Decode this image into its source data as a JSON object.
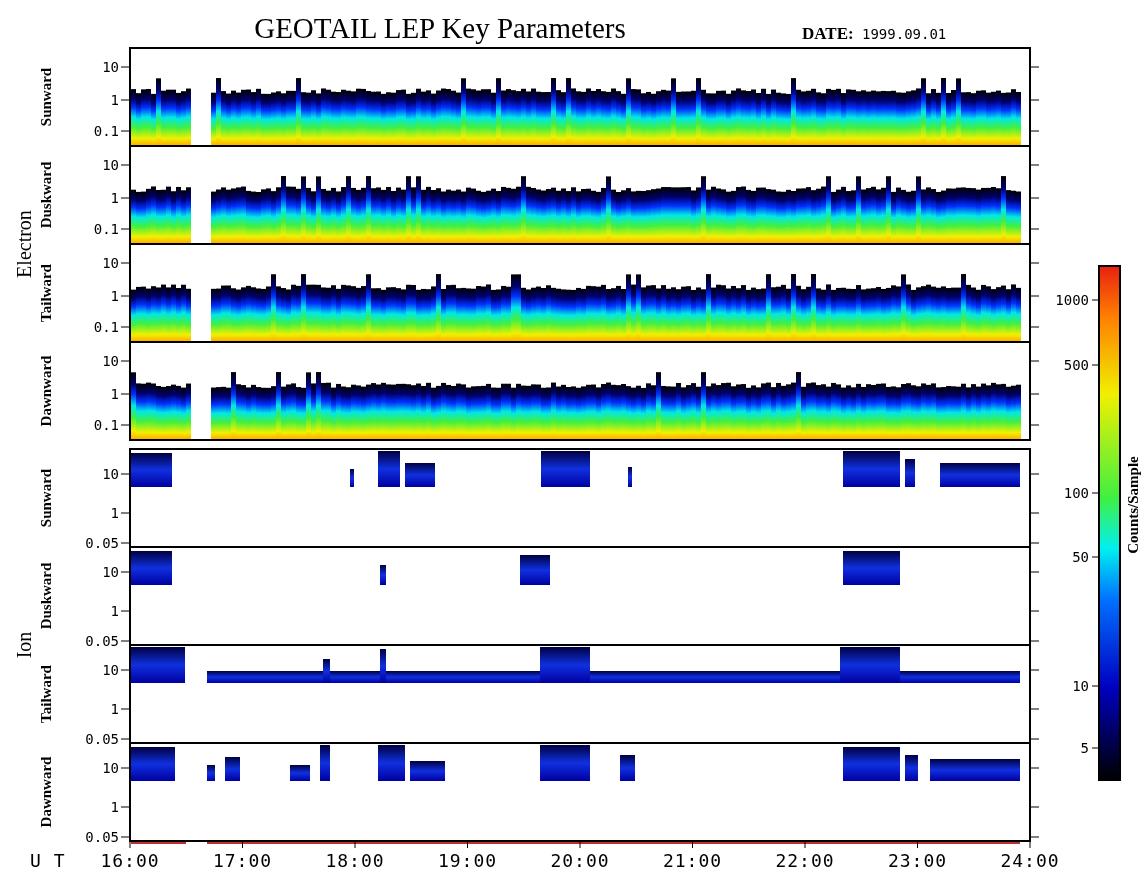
{
  "title": "GEOTAIL LEP Key Parameters",
  "date": {
    "label": "DATE:",
    "value": "1999.09.01"
  },
  "groups": [
    {
      "label": "Electron",
      "kind": "electron",
      "panels": [
        {
          "label": "Sunward",
          "yticks": [
            "10",
            "1",
            "0.1"
          ]
        },
        {
          "label": "Duskward",
          "yticks": [
            "10",
            "1",
            "0.1"
          ]
        },
        {
          "label": "Tailward",
          "yticks": [
            "10",
            "1",
            "0.1"
          ]
        },
        {
          "label": "Dawnward",
          "yticks": [
            "10",
            "1",
            "0.1"
          ]
        }
      ]
    },
    {
      "label": "Ion",
      "kind": "ion",
      "panels": [
        {
          "label": "Sunward",
          "yticks": [
            "10",
            "1",
            "0.05"
          ]
        },
        {
          "label": "Duskward",
          "yticks": [
            "10",
            "1",
            "0.05"
          ]
        },
        {
          "label": "Tailward",
          "yticks": [
            "10",
            "1",
            "0.05"
          ]
        },
        {
          "label": "Dawnward",
          "yticks": [
            "10",
            "1",
            "0.05"
          ]
        }
      ]
    }
  ],
  "x_axis": {
    "label": "U T",
    "ticks": [
      "16:00",
      "17:00",
      "18:00",
      "19:00",
      "20:00",
      "21:00",
      "22:00",
      "23:00",
      "24:00"
    ]
  },
  "colorbar": {
    "label": "Counts/Sample",
    "ticks": [
      "1000",
      "500",
      "100",
      "50",
      "10",
      "5"
    ]
  }
}
